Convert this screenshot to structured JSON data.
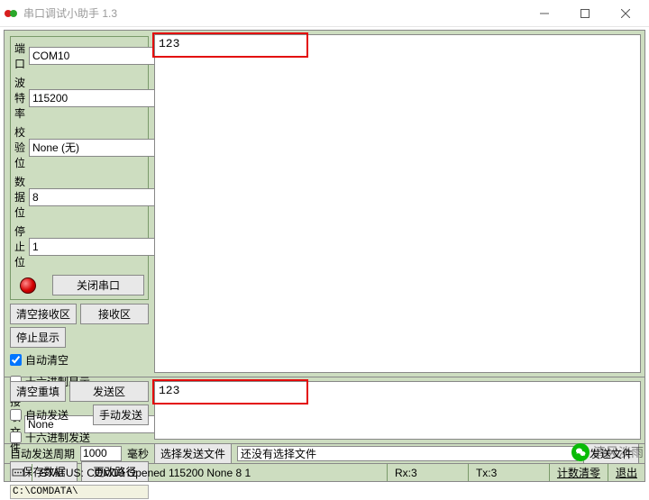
{
  "window": {
    "title": "串口调试小助手 1.3"
  },
  "serial": {
    "port_label": "端 口",
    "port_value": "COM10",
    "baud_label": "波特率",
    "baud_value": "115200",
    "parity_label": "校验位",
    "parity_value": "None (无)",
    "data_label": "数据位",
    "data_value": "8",
    "stop_label": "停止位",
    "stop_value": "1",
    "close_btn": "关闭串口"
  },
  "rx": {
    "clear_btn": "清空接收区",
    "area_label": "接收区",
    "stop_btn": "停止显示",
    "auto_clear": "自动清空",
    "auto_clear_checked": true,
    "hex_display": "十六进制显示",
    "hex_display_checked": false,
    "recv_file_label": "接收文件",
    "recv_file_value": "None",
    "save_btn": "保存数据",
    "path_btn": "更改路径",
    "path_value": "C:\\COMDATA\\",
    "content": "123"
  },
  "tx": {
    "clear_btn": "清空重填",
    "area_label": "发送区",
    "auto_send": "自动发送",
    "auto_send_checked": false,
    "manual_btn": "手动发送",
    "hex_send": "十六进制发送",
    "hex_send_checked": false,
    "period_label": "自动发送周期",
    "period_value": "1000",
    "period_unit": "毫秒",
    "choose_file_btn": "选择发送文件",
    "file_value": "还没有选择文件",
    "send_file_btn": "发送文件",
    "content": "123"
  },
  "status": {
    "text": "STATUS: COM10 Opened 115200 None  8 1",
    "rx_label": "Rx:3",
    "tx_label": "Tx:3",
    "counter_clear": "计数清零",
    "exit": "退出"
  },
  "watermark": "清风淡雨"
}
